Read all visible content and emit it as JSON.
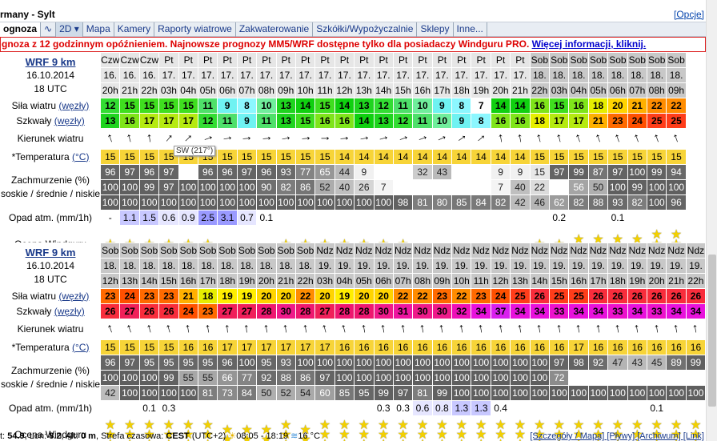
{
  "title": "rmany - Sylt",
  "options_link": "[Opcje]",
  "tabs": [
    {
      "label": "ognoza",
      "sel": false,
      "first": true
    },
    {
      "label": "∿",
      "sel": false
    },
    {
      "label": "2D ▾",
      "sel": true
    },
    {
      "label": "Mapa"
    },
    {
      "label": "Kamery"
    },
    {
      "label": "Raporty wiatrowe"
    },
    {
      "label": "Zakwaterowanie"
    },
    {
      "label": "Szkółki/Wypożyczalnie"
    },
    {
      "label": "Sklepy"
    },
    {
      "label": "Inne..."
    }
  ],
  "warning": "gnoza z 12 godzinnym opóźnieniem. Najnowsze prognozy MM5/WRF dostępne tylko dla posiadaczy Windguru PRO. ",
  "warning_link": "Więcej informacji, kliknij.",
  "tooltip": "SW (217°)",
  "labels": {
    "wind": "Siła wiatru",
    "wind_unit": "(węzły)",
    "gust": "Szkwały",
    "gust_unit": "(węzły)",
    "dir": "Kierunek wiatru",
    "temp": "*Temperatura",
    "temp_unit": "(°C)",
    "cloud1": "Zachmurzenie (%)",
    "cloud2": "soskie / średnie / niskie",
    "precip": "Opad atm. (mm/1h)",
    "rating": "Ocena Windguru"
  },
  "blocks": [
    {
      "model": "WRF 9 km",
      "date": "16.10.2014",
      "utc": "18 UTC",
      "days": [
        "Czw",
        "Czw",
        "Czw",
        "Pt",
        "Pt",
        "Pt",
        "Pt",
        "Pt",
        "Pt",
        "Pt",
        "Pt",
        "Pt",
        "Pt",
        "Pt",
        "Pt",
        "Pt",
        "Pt",
        "Pt",
        "Pt",
        "Pt",
        "Pt",
        "Pt",
        "Sob",
        "Sob",
        "Sob",
        "Sob",
        "Sob",
        "Sob",
        "Sob",
        "Sob"
      ],
      "dates": [
        "16.",
        "16.",
        "16.",
        "17.",
        "17.",
        "17.",
        "17.",
        "17.",
        "17.",
        "17.",
        "17.",
        "17.",
        "17.",
        "17.",
        "17.",
        "17.",
        "17.",
        "17.",
        "17.",
        "17.",
        "17.",
        "17.",
        "18.",
        "18.",
        "18.",
        "18.",
        "18.",
        "18.",
        "18.",
        "18."
      ],
      "hours": [
        "20h",
        "21h",
        "22h",
        "03h",
        "04h",
        "05h",
        "06h",
        "07h",
        "08h",
        "09h",
        "10h",
        "11h",
        "12h",
        "13h",
        "14h",
        "15h",
        "16h",
        "17h",
        "18h",
        "19h",
        "20h",
        "21h",
        "22h",
        "03h",
        "04h",
        "05h",
        "06h",
        "07h",
        "08h",
        "09h"
      ],
      "wind": [
        12,
        15,
        15,
        15,
        15,
        11,
        9,
        8,
        10,
        13,
        14,
        15,
        14,
        13,
        12,
        11,
        10,
        9,
        8,
        7,
        14,
        14,
        16,
        15,
        16,
        18,
        20,
        21,
        22,
        22
      ],
      "gust": [
        13,
        16,
        17,
        17,
        17,
        12,
        11,
        9,
        11,
        13,
        15,
        16,
        16,
        14,
        13,
        12,
        11,
        10,
        9,
        8,
        16,
        16,
        18,
        17,
        17,
        21,
        23,
        24,
        25,
        25
      ],
      "dir": [
        -20,
        -15,
        -10,
        40,
        45,
        70,
        80,
        85,
        85,
        80,
        85,
        90,
        85,
        80,
        75,
        70,
        70,
        65,
        55,
        50,
        -10,
        -10,
        -15,
        -15,
        -20,
        -20,
        -20,
        -20,
        -20,
        -20
      ],
      "temp": [
        15,
        15,
        15,
        15,
        15,
        15,
        15,
        15,
        15,
        15,
        15,
        15,
        14,
        14,
        14,
        14,
        14,
        14,
        14,
        14,
        14,
        14,
        15,
        15,
        15,
        15,
        15,
        15,
        15,
        15
      ],
      "cloud_hi": [
        96,
        97,
        96,
        97,
        "",
        96,
        96,
        97,
        96,
        93,
        77,
        65,
        44,
        9,
        "",
        "",
        32,
        43,
        "",
        "",
        9,
        9,
        15,
        97,
        99,
        87,
        97,
        100,
        99,
        94
      ],
      "cloud_mid": [
        100,
        100,
        99,
        97,
        100,
        100,
        100,
        100,
        90,
        82,
        86,
        52,
        40,
        26,
        7,
        "",
        "",
        "",
        "",
        "",
        7,
        40,
        22,
        "",
        56,
        50,
        100,
        99,
        100,
        100
      ],
      "cloud_lo": [
        100,
        100,
        100,
        100,
        100,
        100,
        100,
        100,
        100,
        100,
        100,
        100,
        100,
        100,
        100,
        98,
        81,
        80,
        85,
        84,
        82,
        42,
        46,
        62,
        82,
        88,
        93,
        82,
        100,
        96
      ],
      "precip": [
        "-",
        "1.1",
        "1.5",
        "0.6",
        "0.9",
        "2.5",
        "3.1",
        "0.7",
        "0.1",
        "",
        "",
        "",
        "",
        "",
        "",
        "",
        "",
        "",
        "",
        "",
        "",
        "",
        "",
        "0.2",
        "",
        "",
        "0.1",
        "",
        "",
        ""
      ],
      "rating": [
        1,
        1,
        1,
        1,
        1,
        1,
        0,
        0,
        0,
        1,
        1,
        1,
        1,
        1,
        1,
        1,
        0,
        0,
        0,
        0,
        0,
        0,
        1,
        1,
        2,
        2,
        2,
        2,
        3,
        3
      ]
    },
    {
      "model": "WRF 9 km",
      "date": "16.10.2014",
      "utc": "18 UTC",
      "days": [
        "Sob",
        "Sob",
        "Sob",
        "Sob",
        "Sob",
        "Sob",
        "Sob",
        "Sob",
        "Sob",
        "Sob",
        "Sob",
        "Ndz",
        "Ndz",
        "Ndz",
        "Ndz",
        "Ndz",
        "Ndz",
        "Ndz",
        "Ndz",
        "Ndz",
        "Ndz",
        "Ndz",
        "Ndz",
        "Ndz",
        "Ndz",
        "Ndz",
        "Ndz",
        "Ndz",
        "Ndz",
        "Ndz",
        "Ndz"
      ],
      "dates": [
        "18.",
        "18.",
        "18.",
        "18.",
        "18.",
        "18.",
        "18.",
        "18.",
        "18.",
        "18.",
        "18.",
        "19.",
        "19.",
        "19.",
        "19.",
        "19.",
        "19.",
        "19.",
        "19.",
        "19.",
        "19.",
        "19.",
        "19.",
        "19.",
        "19.",
        "19.",
        "19.",
        "19.",
        "19.",
        "19.",
        "19."
      ],
      "hours": [
        "12h",
        "13h",
        "14h",
        "15h",
        "16h",
        "17h",
        "18h",
        "19h",
        "20h",
        "21h",
        "22h",
        "03h",
        "04h",
        "05h",
        "06h",
        "07h",
        "08h",
        "09h",
        "10h",
        "11h",
        "12h",
        "13h",
        "14h",
        "15h",
        "16h",
        "17h",
        "18h",
        "19h",
        "20h",
        "21h",
        "22h"
      ],
      "wind": [
        23,
        24,
        23,
        23,
        21,
        18,
        19,
        19,
        20,
        20,
        22,
        20,
        19,
        20,
        20,
        22,
        22,
        23,
        22,
        23,
        24,
        25,
        26,
        25,
        25,
        26,
        26,
        26,
        26,
        26,
        26
      ],
      "gust": [
        26,
        27,
        26,
        26,
        24,
        23,
        27,
        27,
        28,
        30,
        28,
        27,
        28,
        28,
        30,
        31,
        30,
        30,
        32,
        34,
        37,
        34,
        34,
        33,
        34,
        34,
        33,
        34,
        33,
        34,
        34
      ],
      "dir": [
        -20,
        -20,
        -15,
        -15,
        -10,
        -10,
        -5,
        -5,
        -10,
        -10,
        -10,
        -15,
        -15,
        -10,
        -10,
        -10,
        -10,
        -10,
        -10,
        -10,
        -10,
        -10,
        -10,
        -10,
        -10,
        -10,
        -10,
        -10,
        -10,
        -10,
        -10
      ],
      "temp": [
        15,
        15,
        15,
        15,
        16,
        16,
        17,
        17,
        17,
        17,
        17,
        17,
        16,
        16,
        16,
        16,
        16,
        16,
        16,
        16,
        16,
        16,
        16,
        16,
        17,
        16,
        16,
        16,
        16,
        16,
        16
      ],
      "cloud_hi": [
        96,
        97,
        95,
        95,
        95,
        95,
        96,
        100,
        95,
        93,
        100,
        100,
        100,
        100,
        100,
        100,
        100,
        100,
        100,
        100,
        100,
        100,
        100,
        97,
        98,
        92,
        47,
        43,
        45,
        89,
        99
      ],
      "cloud_mid": [
        100,
        100,
        100,
        99,
        55,
        55,
        66,
        77,
        92,
        88,
        86,
        97,
        100,
        100,
        100,
        100,
        100,
        100,
        100,
        100,
        100,
        100,
        100,
        72,
        "",
        "",
        "",
        "",
        "",
        "",
        ""
      ],
      "cloud_lo": [
        42,
        100,
        100,
        100,
        100,
        81,
        73,
        84,
        50,
        52,
        54,
        60,
        85,
        95,
        99,
        97,
        81,
        99,
        100,
        100,
        100,
        100,
        100,
        100,
        100,
        100,
        100,
        100,
        100,
        100,
        100
      ],
      "precip": [
        "",
        "",
        "0.1",
        "0.3",
        "",
        "",
        "",
        "",
        "",
        "",
        "",
        "",
        "",
        "",
        "0.3",
        "0.3",
        "0.6",
        "0.8",
        "1.3",
        "1.3",
        "0.4",
        "",
        "",
        "",
        "",
        "",
        "",
        "",
        "0.1",
        "",
        ""
      ],
      "rating": [
        3,
        3,
        3,
        3,
        3,
        3,
        2,
        2,
        2,
        3,
        2,
        3,
        3,
        3,
        3,
        3,
        3,
        3,
        3,
        3,
        3,
        3,
        3,
        3,
        3,
        3,
        3,
        3,
        3,
        3,
        3
      ]
    }
  ],
  "footer": {
    "lat_label": "t:",
    "lat": "54.9",
    "lon_label": "Lon:",
    "lon": "8.2",
    "alt_label": "Alt:",
    "alt": "0 m",
    "tz_label": "Strefa czasowa:",
    "tz": "CEST",
    "tz_off": "(UTC+2)",
    "sun": "08:05 - 18:19",
    "water": "16 °C",
    "links": "[Szczegóły / Mapa] [Pływy] [Archiwum] [Link]"
  },
  "colors": {
    "warning": "#dd0000",
    "link": "#1a3a8a",
    "temp": "#f7d438"
  }
}
